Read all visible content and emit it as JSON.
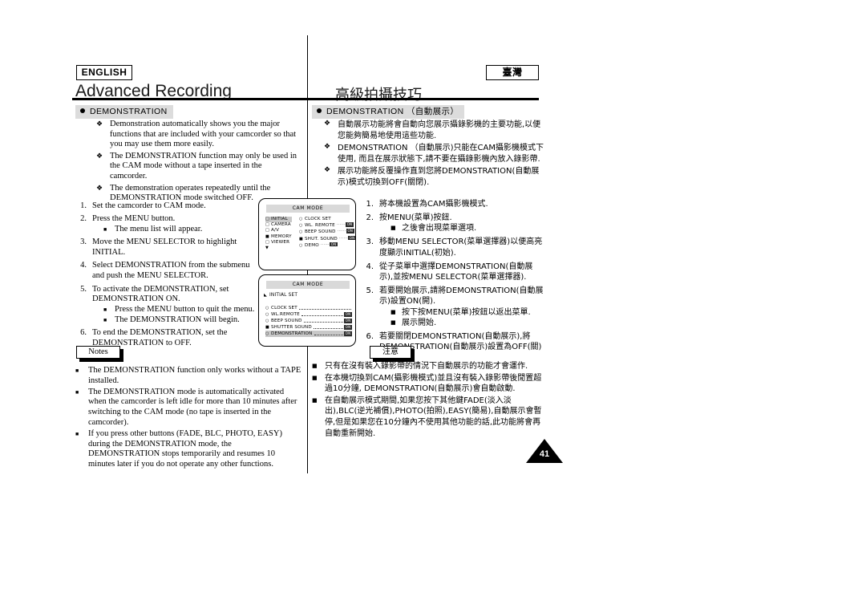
{
  "header": {
    "english_badge": "ENGLISH",
    "region_badge": "臺灣",
    "title_en": "Advanced Recording",
    "title_zh": "高級拍攝技巧"
  },
  "section": {
    "heading_en": "DEMONSTRATION",
    "heading_zh": "DEMONSTRATION （自動展示）"
  },
  "intro_en": [
    "Demonstration automatically shows you the major functions that are included with your camcorder so that you may use them more easily.",
    "The DEMONSTRATION function may only be used in the CAM mode without a tape inserted in the camcorder.",
    "The demonstration operates repeatedly until the DEMONSTRATION mode switched OFF."
  ],
  "intro_zh": [
    "自動展示功能將會自動向您展示攝錄影機的主要功能,以便您能夠簡易地使用這些功能.",
    "DEMONSTRATION （自動展示)只能在CAM攝影機模式下使用, 而且在展示狀態下,請不要在攝錄影機內放入錄影帶.",
    "展示功能將反覆操作直到您將DEMONSTRATION(自動展示)模式切換到OFF(關閉)."
  ],
  "steps_en": [
    {
      "num": "1.",
      "text": "Set the camcorder to CAM mode.",
      "sub": []
    },
    {
      "num": "2.",
      "text": "Press the MENU button.",
      "sub": [
        "The menu list will appear."
      ]
    },
    {
      "num": "3.",
      "text": "Move the MENU SELECTOR to highlight INITIAL.",
      "sub": []
    },
    {
      "num": "4.",
      "text": "Select DEMONSTRATION from the submenu and push the MENU SELECTOR.",
      "sub": []
    },
    {
      "num": "5.",
      "text": "To activate the DEMONSTRATION, set DEMONSTRATION ON.",
      "sub": [
        "Press the MENU button to quit the menu.",
        "The DEMONSTRATION will begin."
      ]
    },
    {
      "num": "6.",
      "text": "To end the DEMONSTRATION, set the DEMONSTRATION to OFF.",
      "sub": []
    }
  ],
  "steps_zh": [
    {
      "num": "1.",
      "text": "將本機設置為CAM攝影機模式.",
      "sub": []
    },
    {
      "num": "2.",
      "text": "按MENU(菜單)按鈕.",
      "sub": [
        "之後會出現菜單選項."
      ]
    },
    {
      "num": "3.",
      "text": "移動MENU SELECTOR(菜單選擇器)以便高亮度顯示INITIAL(初始).",
      "sub": []
    },
    {
      "num": "4.",
      "text": "從子菜單中選擇DEMONSTRATION(自動展示),並按MENU SELECTOR(菜單選擇器).",
      "sub": []
    },
    {
      "num": "5.",
      "text": "若要開始展示,請將DEMONSTRATION(自動展示)設置ON(開).",
      "sub": [
        "按下按MENU(菜單)按鈕以返出菜單.",
        "展示開始."
      ]
    },
    {
      "num": "6.",
      "text": "若要關閉DEMONSTRATION(自動展示),將DEMONSTRATION(自動展示)設置為OFF(關)即可.",
      "sub": []
    }
  ],
  "notes_en": {
    "caption": "Notes",
    "items": [
      "The DEMONSTRATION function only works without a TAPE installed.",
      "The DEMONSTRATION mode is automatically activated when the camcorder is left idle for more than 10 minutes after switching to the CAM mode (no tape is inserted in the camcorder).",
      "If you press other buttons (FADE, BLC, PHOTO, EASY) during the DEMONSTRATION mode, the DEMONSTRATION stops temporarily and resumes 10 minutes later if you do not operate any other functions."
    ]
  },
  "notes_zh": {
    "caption": "注意",
    "items": [
      "只有在沒有裝入錄影帶的情況下自動展示的功能才會運作.",
      "在本機切換到CAM(攝影機模式)並且沒有裝入錄影帶後閒置超過10分鐘, DEMONSTRATION(自動展示)會自動啟動.",
      "在自動展示模式期間,如果您按下其他鍵FADE(淡入淡出),BLC(逆光補償),PHOTO(拍照),EASY(簡易),自動展示會暫停,但是如果您在10分鐘內不使用其他功能的話,此功能將會再自動重新開始."
    ]
  },
  "lcd_menu_1": {
    "title": "CAM MODE",
    "left_items": [
      {
        "label": "INITIAL",
        "selected": true,
        "marker": "open"
      },
      {
        "label": "CAMERA",
        "selected": false,
        "marker": "open"
      },
      {
        "label": "A/V",
        "selected": false,
        "marker": "open"
      },
      {
        "label": "MEMORY",
        "selected": false,
        "marker": "filled"
      },
      {
        "label": "VIEWER",
        "selected": false,
        "marker": "open"
      }
    ],
    "right_items": [
      {
        "label": "CLOCK  SET",
        "marker": "open",
        "value": ""
      },
      {
        "label": "WL. REMOTE",
        "marker": "open",
        "value": "ON"
      },
      {
        "label": "BEEP SOUND",
        "marker": "open",
        "value": "ON"
      },
      {
        "label": "SHUT. SOUND",
        "marker": "filled",
        "value": "ON"
      },
      {
        "label": "DEMO",
        "marker": "open",
        "value": "ON"
      }
    ]
  },
  "lcd_menu_2": {
    "title": "CAM MODE",
    "header": "INITIAL SET",
    "items": [
      {
        "label": "CLOCK  SET",
        "marker": "open",
        "value": "",
        "selected": false
      },
      {
        "label": "WL.REMOTE",
        "marker": "open",
        "value": "ON",
        "selected": false
      },
      {
        "label": "BEEP SOUND",
        "marker": "open",
        "value": "ON",
        "selected": false
      },
      {
        "label": "SHUTTER SOUND",
        "marker": "filled",
        "value": "ON",
        "selected": false
      },
      {
        "label": "DEMONSTRATION",
        "marker": "open",
        "value": "ON",
        "selected": true
      }
    ]
  },
  "page_number": "41"
}
